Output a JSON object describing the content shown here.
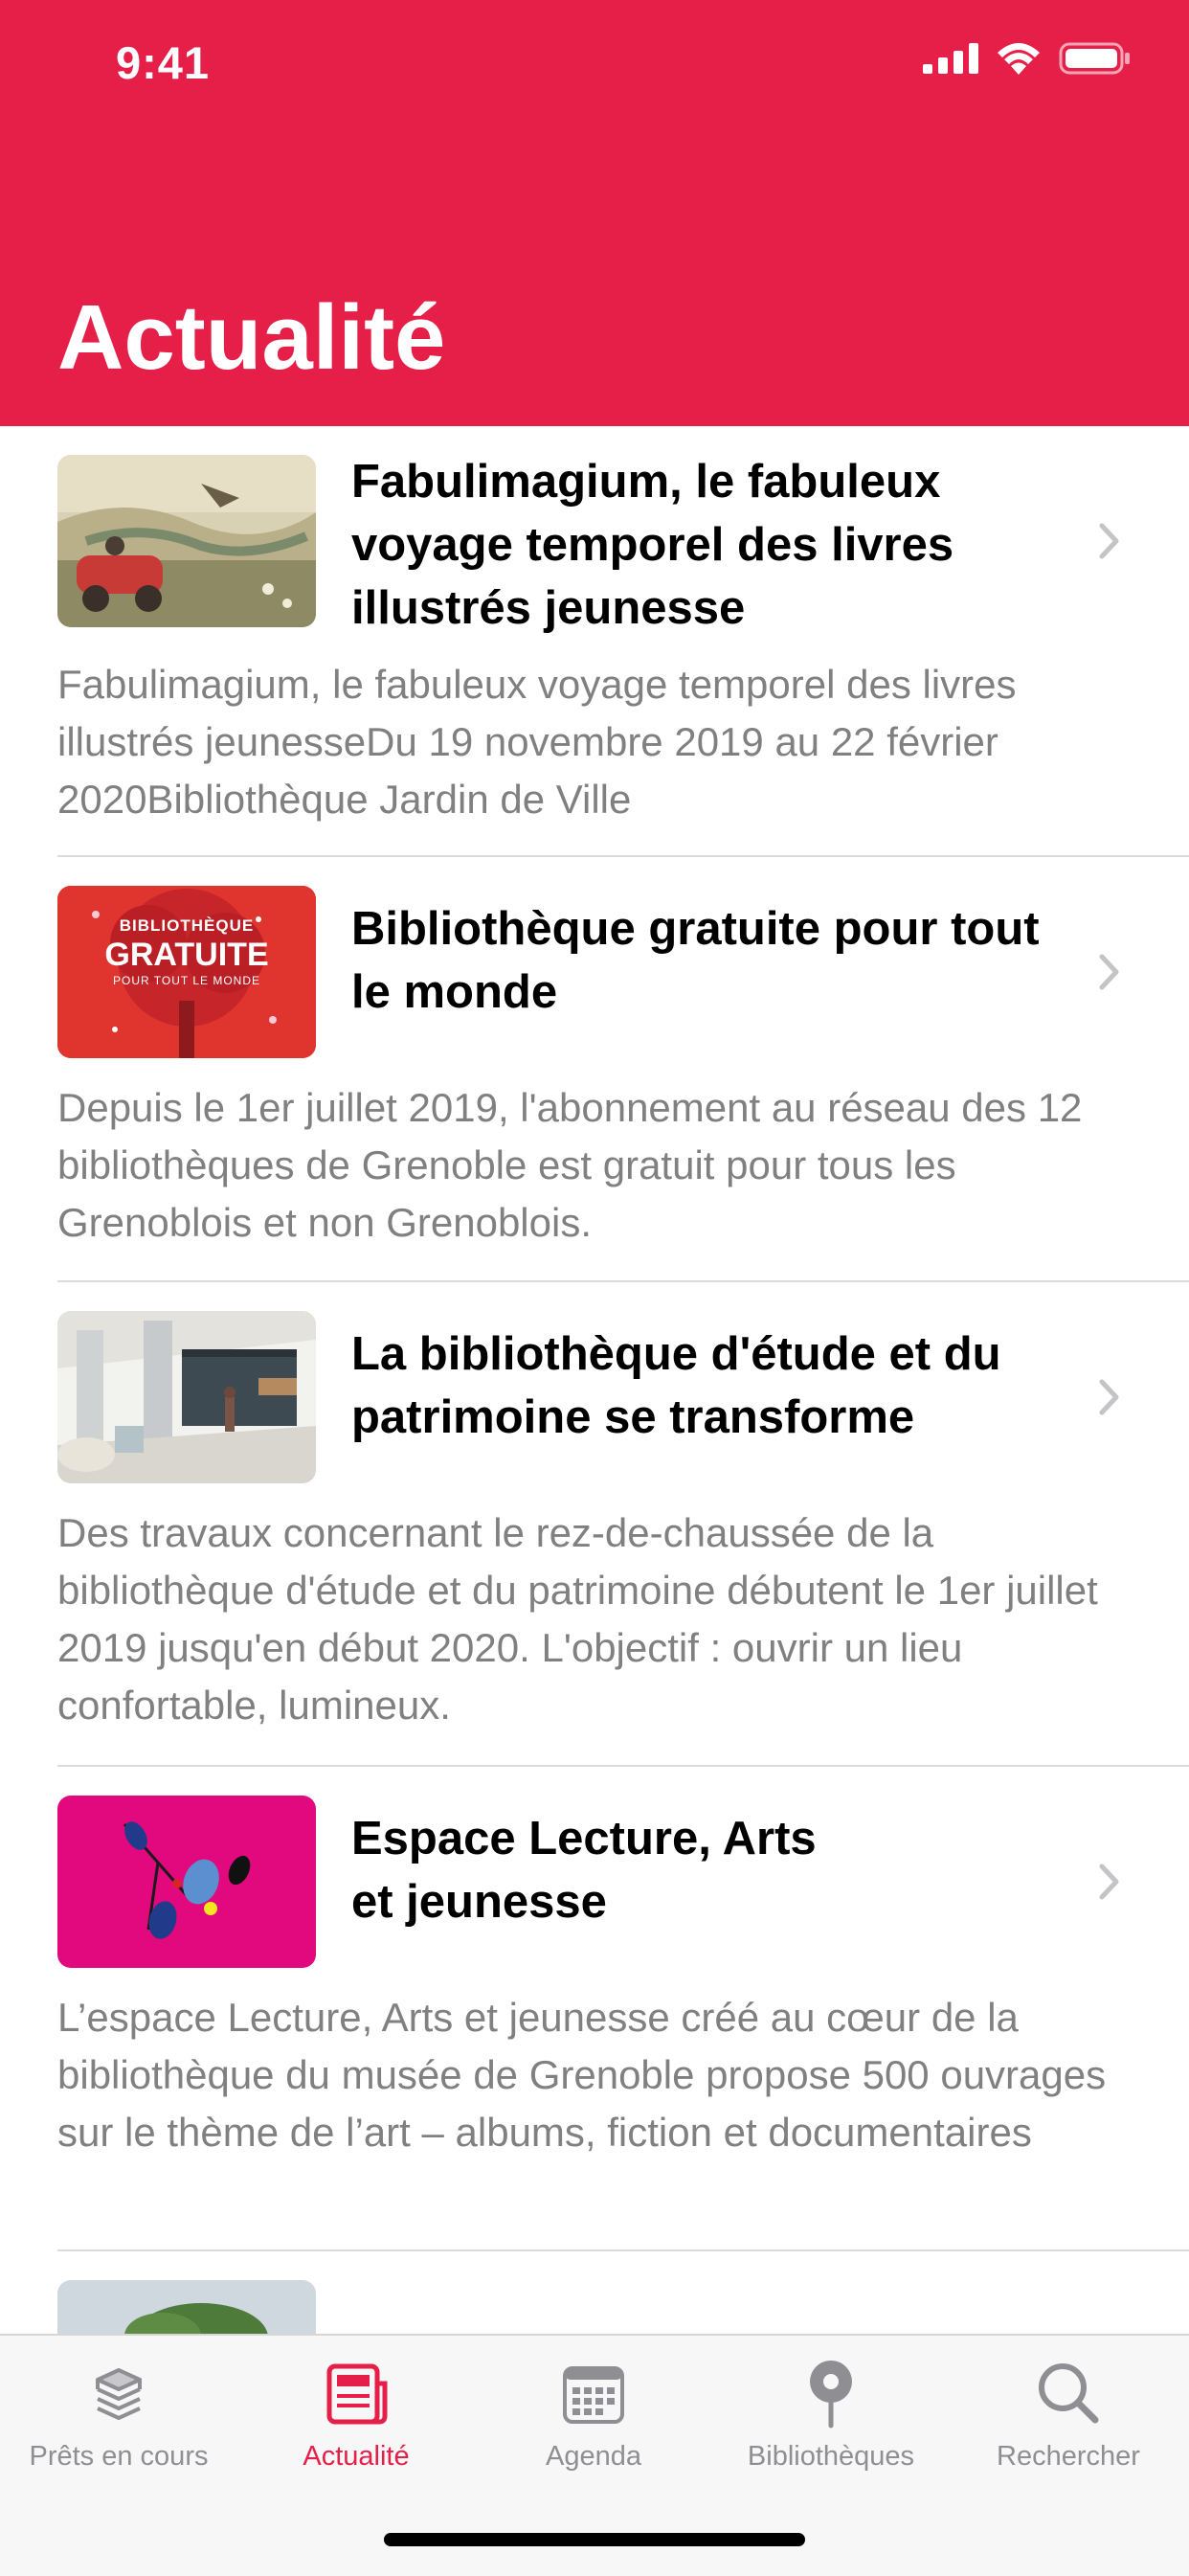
{
  "status_bar": {
    "time": "9:41",
    "icons": [
      "cellular-signal-icon",
      "wifi-icon",
      "battery-icon"
    ]
  },
  "page": {
    "title": "Actualité"
  },
  "colors": {
    "accent": "#e51f48",
    "text_primary": "#000000",
    "text_secondary": "#808080",
    "tab_inactive": "#8e8e93",
    "separator": "#dcdcdc"
  },
  "news": [
    {
      "title": "Fabulimagium, le fabuleux\nvoyage temporel des livres\nillustrés jeunesse",
      "description": "Fabulimagium, le fabuleux voyage temporel des livres illustrés jeunesseDu 19 novembre 2019 au 22 février 2020Bibliothèque Jardin de Ville"
    },
    {
      "title": "Bibliothèque gratuite pour tout\nle monde",
      "description": "Depuis le 1er juillet 2019, l'abonnement au réseau des 12 bibliothèques de Grenoble est gratuit pour tous les Grenoblois et non Grenoblois.",
      "thumbnail_text": {
        "line1": "BIBLIOTHÈQUE",
        "line2": "GRATUITE",
        "line3": "POUR TOUT LE MONDE"
      }
    },
    {
      "title": "La bibliothèque d'étude et du\npatrimoine se transforme",
      "description": "Des travaux concernant le rez-de-chaussée de la bibliothèque d'étude et du patrimoine débutent le 1er juillet 2019 jusqu'en début 2020. L'objectif : ouvrir un lieu confortable, lumineux."
    },
    {
      "title": "Espace Lecture, Arts\net jeunesse",
      "description": "L’espace Lecture, Arts et jeunesse créé au cœur de la bibliothèque du musée de Grenoble propose 500 ouvrages sur le thème de l’art – albums, fiction et documentaires"
    }
  ],
  "tabbar": {
    "tabs": [
      {
        "label": "Prêts en cours",
        "icon": "stacked-books-icon",
        "active": false
      },
      {
        "label": "Actualité",
        "icon": "newspaper-icon",
        "active": true
      },
      {
        "label": "Agenda",
        "icon": "calendar-icon",
        "active": false
      },
      {
        "label": "Bibliothèques",
        "icon": "map-pin-icon",
        "active": false
      },
      {
        "label": "Rechercher",
        "icon": "search-icon",
        "active": false
      }
    ]
  }
}
